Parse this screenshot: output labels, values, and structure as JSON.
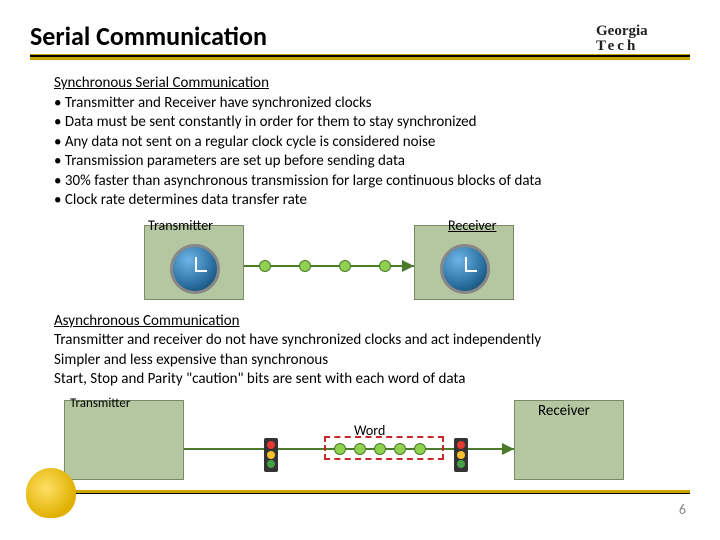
{
  "title": "Serial Communication",
  "logo": {
    "line1": "Georgia",
    "line2": "Tech"
  },
  "sync": {
    "heading": "Synchronous Serial Communication",
    "bullets": [
      "Transmitter and Receiver have synchronized clocks",
      "Data must be sent constantly in order for them to stay synchronized",
      "Any data not sent on a regular clock cycle is considered noise",
      "Transmission parameters are set up before sending data",
      "30% faster than asynchronous transmission for large continuous blocks of data",
      "Clock rate determines data transfer rate"
    ],
    "tx_label": "Transmitter",
    "rx_label": "Receiver"
  },
  "async": {
    "heading": "Asynchronous Communication",
    "lines": [
      "Transmitter and receiver do not have synchronized clocks and act independently",
      "Simpler and less expensive than synchronous",
      "Start, Stop and Parity \"caution\" bits are sent with each word of data"
    ],
    "tx_label": "Transmitter",
    "rx_label": "Receiver",
    "word_label": "Word"
  },
  "page_number": "6"
}
